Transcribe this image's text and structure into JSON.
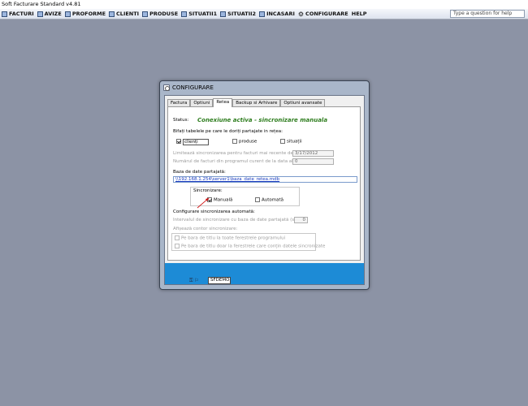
{
  "app": {
    "title": "Soft Facturare Standard v4.81",
    "help_placeholder": "Type a question for help"
  },
  "menu": [
    {
      "label": "FACTURI",
      "icon": "invoice-icon"
    },
    {
      "label": "AVIZE",
      "icon": "notice-icon"
    },
    {
      "label": "PROFORME",
      "icon": "proforma-icon"
    },
    {
      "label": "CLIENTI",
      "icon": "clients-icon"
    },
    {
      "label": "PRODUSE",
      "icon": "products-icon"
    },
    {
      "label": "SITUATII1",
      "icon": "report-icon"
    },
    {
      "label": "SITUATII2",
      "icon": "report-icon"
    },
    {
      "label": "INCASARI",
      "icon": "cash-icon"
    },
    {
      "label": "CONFIGURARE",
      "icon": "gear-icon"
    },
    {
      "label": "HELP",
      "icon": ""
    }
  ],
  "dialog": {
    "title": "CONFIGURARE",
    "tabs": [
      "Factura",
      "Optiuni",
      "Retea",
      "Backup si Arhivare",
      "Optiuni avansate"
    ],
    "active_tab": "Retea",
    "status_label": "Status:",
    "status_value": "Conexiune activa - sincronizare manuala",
    "share_label": "Bifați tabelele pe care le doriți partajate in rețea:",
    "tables": [
      {
        "label": "clienți",
        "checked": true
      },
      {
        "label": "produse",
        "checked": false
      },
      {
        "label": "situații",
        "checked": false
      }
    ],
    "limit_label": "Limitează sincronizarea pentru facturi mai recente de:",
    "limit_value": "3/17/2012",
    "count_label": "Numărul de facturi din programul curent de la data aleasă:",
    "count_value": "0",
    "db_label": "Baza de date partajată:",
    "db_path": "\\\\192.168.1.254\\server1\\baza_date_retea.mdb",
    "sync_group": "Sincronizare:",
    "sync_options": [
      {
        "label": "Manuală",
        "checked": true
      },
      {
        "label": "Automată",
        "checked": false
      }
    ],
    "auto_label": "Configurare sincronizarea automată:",
    "interval_label": "Intervalul de sincronizare cu baza de date partajată (sec.):",
    "interval_value": "0",
    "counter_label": "Afișează contor sincronizare:",
    "counter_options": [
      "Pe bara de titlu la toate ferestrele programului",
      "Pe bara de titlu doar la ferestrele care conțin datele sincronizate"
    ],
    "user_value": "SFDEMO"
  },
  "colors": {
    "desktop": "#8c93a5",
    "footer_band": "#1d8bd6",
    "status_green": "#2e7d1e"
  }
}
